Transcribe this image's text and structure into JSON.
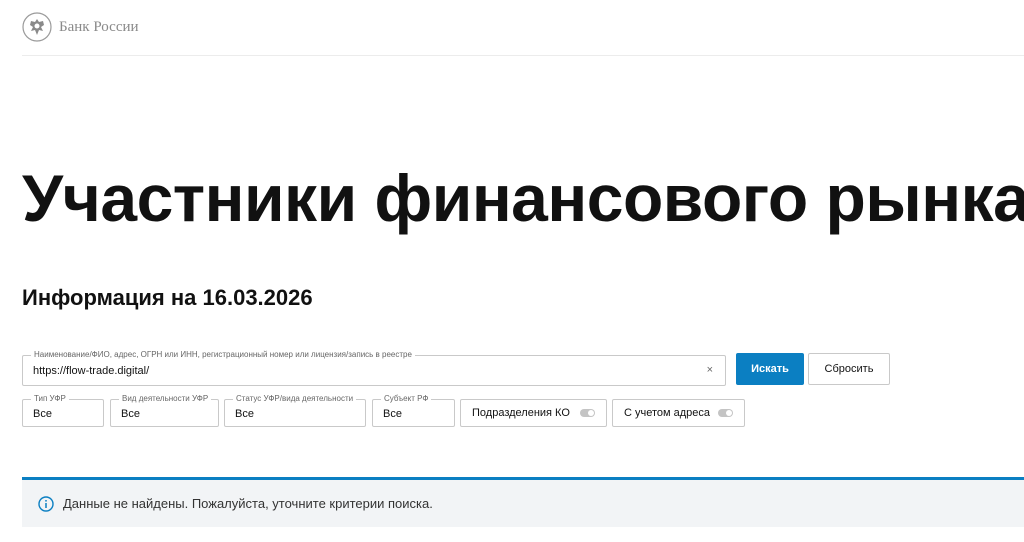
{
  "header": {
    "logo_text": "Банк России",
    "logo_icon": "double-headed-eagle-emblem",
    "colors": {
      "logo_text": "#8a8a8a",
      "divider": "#ececec"
    }
  },
  "page_title": "Участники финансового рынка",
  "info_date_title": "Информация на 16.03.2026",
  "search": {
    "label": "Наименование/ФИО, адрес, ОГРН или ИНН, регистрационный номер или лицензия/запись в реестре",
    "value": "https://flow-trade.digital/",
    "clear_symbol": "×",
    "submit_label": "Искать",
    "reset_label": "Сбросить"
  },
  "filters": [
    {
      "label": "Тип УФР",
      "value": "Все"
    },
    {
      "label": "Вид деятельности УФР",
      "value": "Все"
    },
    {
      "label": "Статус УФР/вида деятельности",
      "value": "Все"
    },
    {
      "label": "Субъект РФ",
      "value": "Все"
    }
  ],
  "toggles": [
    {
      "label": "Подразделения КО",
      "checked": false
    },
    {
      "label": "С учетом адреса",
      "checked": false
    }
  ],
  "message": {
    "icon": "info-icon",
    "text": "Данные не найдены. Пожалуйста, уточните критерии поиска."
  },
  "colors": {
    "accent": "#0b7fc2",
    "info_bg": "#f2f4f6",
    "border": "#c9c9c9"
  }
}
